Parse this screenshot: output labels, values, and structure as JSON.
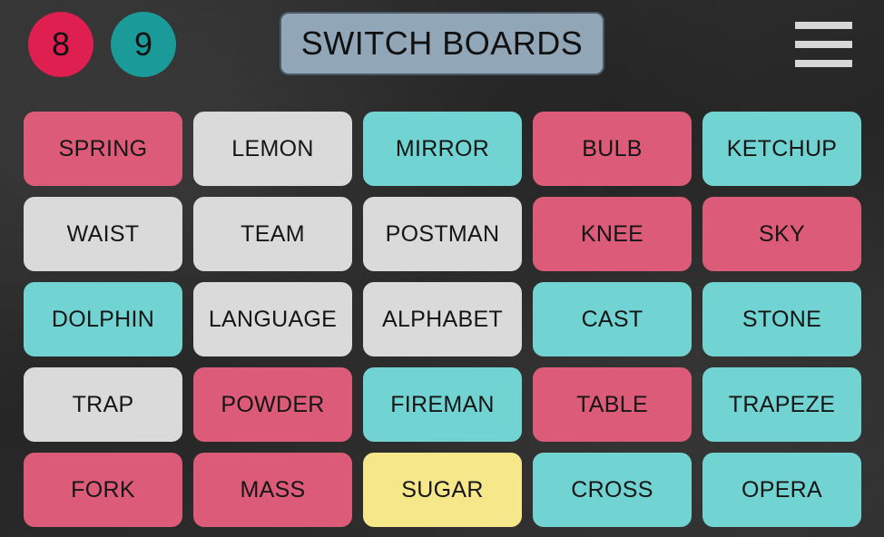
{
  "scores": {
    "red": "8",
    "teal": "9"
  },
  "header": {
    "switch_label": "SWITCH BOARDS",
    "menu_icon": "hamburger-menu-icon"
  },
  "colors": {
    "red": "#dc5b78",
    "white": "#dadada",
    "teal": "#71d3d2",
    "yellow": "#f7e78b",
    "red_score": "#df1f4f",
    "teal_score": "#1a9b9a",
    "switch_button": "#91a7b8"
  },
  "board": {
    "cards": [
      {
        "word": "SPRING",
        "color": "red"
      },
      {
        "word": "LEMON",
        "color": "white"
      },
      {
        "word": "MIRROR",
        "color": "teal"
      },
      {
        "word": "BULB",
        "color": "red"
      },
      {
        "word": "KETCHUP",
        "color": "teal"
      },
      {
        "word": "WAIST",
        "color": "white"
      },
      {
        "word": "TEAM",
        "color": "white"
      },
      {
        "word": "POSTMAN",
        "color": "white"
      },
      {
        "word": "KNEE",
        "color": "red"
      },
      {
        "word": "SKY",
        "color": "red"
      },
      {
        "word": "DOLPHIN",
        "color": "teal"
      },
      {
        "word": "LANGUAGE",
        "color": "white"
      },
      {
        "word": "ALPHABET",
        "color": "white"
      },
      {
        "word": "CAST",
        "color": "teal"
      },
      {
        "word": "STONE",
        "color": "teal"
      },
      {
        "word": "TRAP",
        "color": "white"
      },
      {
        "word": "POWDER",
        "color": "red"
      },
      {
        "word": "FIREMAN",
        "color": "teal"
      },
      {
        "word": "TABLE",
        "color": "red"
      },
      {
        "word": "TRAPEZE",
        "color": "teal"
      },
      {
        "word": "FORK",
        "color": "red"
      },
      {
        "word": "MASS",
        "color": "red"
      },
      {
        "word": "SUGAR",
        "color": "yellow"
      },
      {
        "word": "CROSS",
        "color": "teal"
      },
      {
        "word": "OPERA",
        "color": "teal"
      }
    ]
  }
}
